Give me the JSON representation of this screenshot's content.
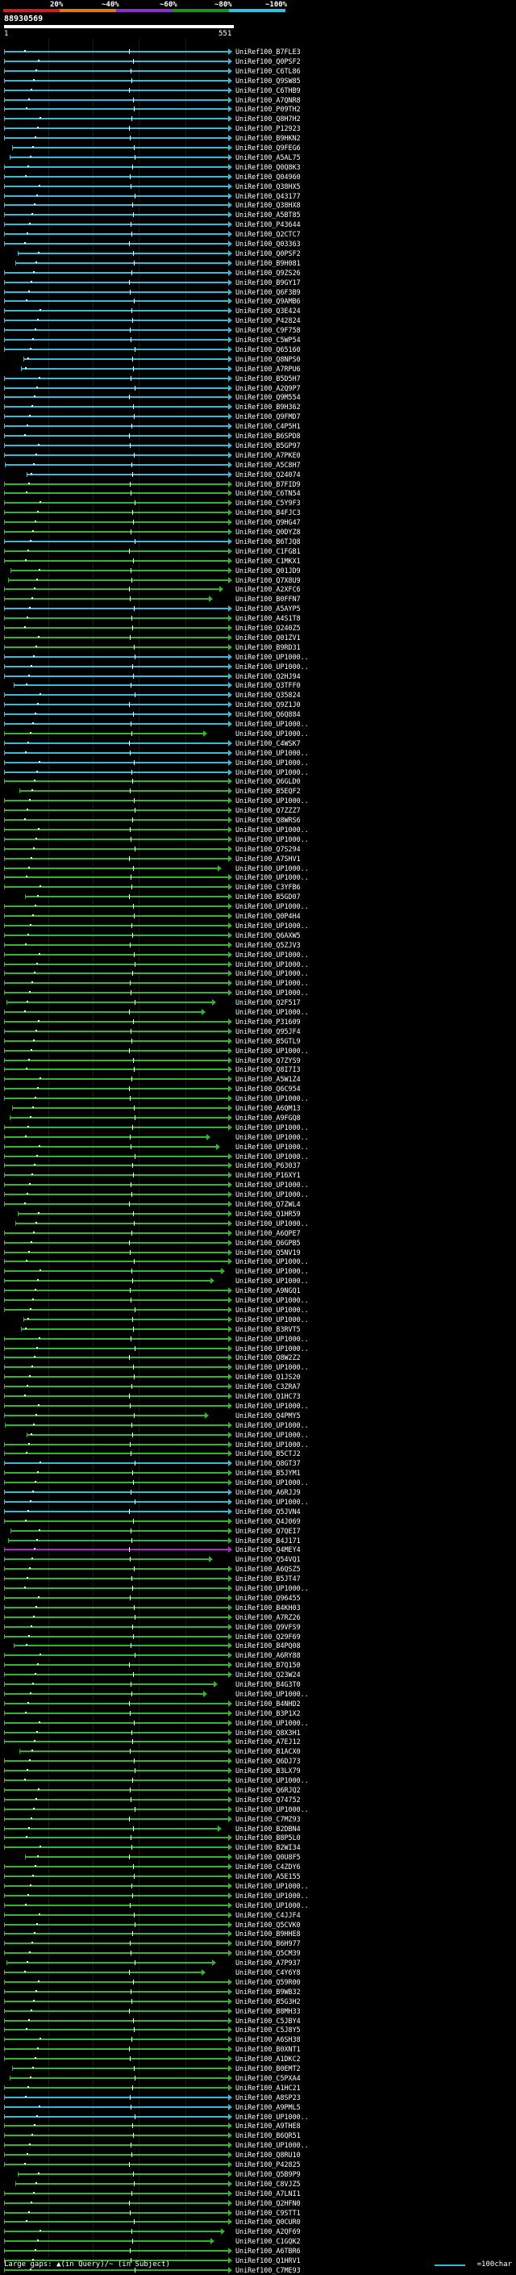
{
  "scale": {
    "ticks": [
      "20%",
      "~40%",
      "~60%",
      "~80%",
      "~100%"
    ],
    "colors": [
      "#cc1f1f",
      "#e07a17",
      "#8b2fc9",
      "#1f8f1f",
      "#33c1e0"
    ]
  },
  "query": {
    "id": "88930569",
    "start": "1",
    "end": "551"
  },
  "colors": {
    "blue": "#39b9d8",
    "green": "#37b42f",
    "magenta": "#b02cc5",
    "white": "#ffffff",
    "background": "#000000"
  },
  "hits": [
    {
      "label": "UniRef100_B7FLE3",
      "color": "blue"
    },
    {
      "label": "UniRef100_Q0PSF2",
      "color": "blue"
    },
    {
      "label": "UniRef100_C6TL86",
      "color": "blue"
    },
    {
      "label": "UniRef100_Q9SW85",
      "color": "blue"
    },
    {
      "label": "UniRef100_C6THB9",
      "color": "blue"
    },
    {
      "label": "UniRef100_A7QNR8",
      "color": "blue"
    },
    {
      "label": "UniRef100_P09TH2",
      "color": "blue"
    },
    {
      "label": "UniRef100_Q8H7H2",
      "color": "blue"
    },
    {
      "label": "UniRef100_P12923",
      "color": "blue"
    },
    {
      "label": "UniRef100_B9HKN2",
      "color": "blue"
    },
    {
      "label": "UniRef100_Q9FEG6",
      "color": "blue"
    },
    {
      "label": "UniRef100_A5AL75",
      "color": "blue"
    },
    {
      "label": "UniRef100_Q0Q8K3",
      "color": "blue"
    },
    {
      "label": "UniRef100_Q04960",
      "color": "blue"
    },
    {
      "label": "UniRef100_Q38HX5",
      "color": "blue"
    },
    {
      "label": "UniRef100_Q43177",
      "color": "blue"
    },
    {
      "label": "UniRef100_Q38HX8",
      "color": "blue"
    },
    {
      "label": "UniRef100_A5BT85",
      "color": "blue"
    },
    {
      "label": "UniRef100_P43644",
      "color": "blue"
    },
    {
      "label": "UniRef100_Q2CTC7",
      "color": "blue"
    },
    {
      "label": "UniRef100_Q03363",
      "color": "blue"
    },
    {
      "label": "UniRef100_Q0PSF2",
      "color": "blue"
    },
    {
      "label": "UniRef100_B9H081",
      "color": "blue"
    },
    {
      "label": "UniRef100_Q9ZS26",
      "color": "blue"
    },
    {
      "label": "UniRef100_B9GY17",
      "color": "blue"
    },
    {
      "label": "UniRef100_Q6F3B9",
      "color": "blue"
    },
    {
      "label": "UniRef100_Q9AMB6",
      "color": "blue"
    },
    {
      "label": "UniRef100_Q3E424",
      "color": "blue"
    },
    {
      "label": "UniRef100_P42824",
      "color": "blue"
    },
    {
      "label": "UniRef100_C9F758",
      "color": "blue"
    },
    {
      "label": "UniRef100_C5WP54",
      "color": "blue"
    },
    {
      "label": "UniRef100_Q65160",
      "color": "blue"
    },
    {
      "label": "UniRef100_Q8NPS0",
      "color": "blue"
    },
    {
      "label": "UniRef100_A7RPU6",
      "color": "blue"
    },
    {
      "label": "UniRef100_B5D5H7",
      "color": "blue"
    },
    {
      "label": "UniRef100_A2Q9P7",
      "color": "blue"
    },
    {
      "label": "UniRef100_Q9M554",
      "color": "blue"
    },
    {
      "label": "UniRef100_B9H362",
      "color": "blue"
    },
    {
      "label": "UniRef100_Q9FMD7",
      "color": "blue"
    },
    {
      "label": "UniRef100_C4P5H1",
      "color": "blue"
    },
    {
      "label": "UniRef100_B6SPD8",
      "color": "blue"
    },
    {
      "label": "UniRef100_B5GP97",
      "color": "blue"
    },
    {
      "label": "UniRef100_A7PKE0",
      "color": "blue"
    },
    {
      "label": "UniRef100_A5C8H7",
      "color": "blue"
    },
    {
      "label": "UniRef100_Q24074",
      "color": "blue"
    },
    {
      "label": "UniRef100_B7FID9",
      "color": "green"
    },
    {
      "label": "UniRef100_C6TN54",
      "color": "green"
    },
    {
      "label": "UniRef100_C5Y9F3",
      "color": "green"
    },
    {
      "label": "UniRef100_B4FJC3",
      "color": "green"
    },
    {
      "label": "UniRef100_Q9HG47",
      "color": "green"
    },
    {
      "label": "UniRef100_Q0DYZ8",
      "color": "green"
    },
    {
      "label": "UniRef100_B6TJQ8",
      "color": "blue"
    },
    {
      "label": "UniRef100_C1FGB1",
      "color": "green"
    },
    {
      "label": "UniRef100_C1MKX1",
      "color": "green"
    },
    {
      "label": "UniRef100_Q01JD9",
      "color": "green"
    },
    {
      "label": "UniRef100_Q7X8U9",
      "color": "green"
    },
    {
      "label": "UniRef100_A2XFC6",
      "color": "green"
    },
    {
      "label": "UniRef100_B0FFN7",
      "color": "green"
    },
    {
      "label": "UniRef100_A5AYP5",
      "color": "blue"
    },
    {
      "label": "UniRef100_A4S1T8",
      "color": "green"
    },
    {
      "label": "UniRef100_Q240Z5",
      "color": "green"
    },
    {
      "label": "UniRef100_Q01ZV1",
      "color": "green"
    },
    {
      "label": "UniRef100_B9RD31",
      "color": "green"
    },
    {
      "label": "UniRef100_UP1000..",
      "color": "blue"
    },
    {
      "label": "UniRef100_UP1000..",
      "color": "blue"
    },
    {
      "label": "UniRef100_Q2HJ94",
      "color": "blue"
    },
    {
      "label": "UniRef100_Q3TFF0",
      "color": "blue"
    },
    {
      "label": "UniRef100_Q35824",
      "color": "blue"
    },
    {
      "label": "UniRef100_Q9Z1J0",
      "color": "blue"
    },
    {
      "label": "UniRef100_Q6Q884",
      "color": "blue"
    },
    {
      "label": "UniRef100_UP1000..",
      "color": "blue"
    },
    {
      "label": "UniRef100_UP1000..",
      "color": "green"
    },
    {
      "label": "UniRef100_C4WSK7",
      "color": "blue"
    },
    {
      "label": "UniRef100_UP1000..",
      "color": "blue"
    },
    {
      "label": "UniRef100_UP1000..",
      "color": "blue"
    },
    {
      "label": "UniRef100_UP1000..",
      "color": "blue"
    },
    {
      "label": "UniRef100_Q6GLD0",
      "color": "green"
    },
    {
      "label": "UniRef100_B5EQF2",
      "color": "green"
    },
    {
      "label": "UniRef100_UP1000..",
      "color": "green"
    },
    {
      "label": "UniRef100_Q7ZZZ7",
      "color": "green"
    },
    {
      "label": "UniRef100_Q8WRS6",
      "color": "green"
    },
    {
      "label": "UniRef100_UP1000..",
      "color": "green"
    },
    {
      "label": "UniRef100_UP1000..",
      "color": "green"
    },
    {
      "label": "UniRef100_Q7S294",
      "color": "green"
    },
    {
      "label": "UniRef100_A7SHV1",
      "color": "green"
    },
    {
      "label": "UniRef100_UP1000..",
      "color": "green"
    },
    {
      "label": "UniRef100_UP1000..",
      "color": "green"
    },
    {
      "label": "UniRef100_C3YFB6",
      "color": "green"
    },
    {
      "label": "UniRef100_B5GD07",
      "color": "green"
    },
    {
      "label": "UniRef100_UP1000..",
      "color": "green"
    },
    {
      "label": "UniRef100_Q0P4H4",
      "color": "green"
    },
    {
      "label": "UniRef100_UP1000..",
      "color": "green"
    },
    {
      "label": "UniRef100_Q6AXW5",
      "color": "green"
    },
    {
      "label": "UniRef100_Q5ZJV3",
      "color": "green"
    },
    {
      "label": "UniRef100_UP1000..",
      "color": "green"
    },
    {
      "label": "UniRef100_UP1000..",
      "color": "green"
    },
    {
      "label": "UniRef100_UP1000..",
      "color": "green"
    },
    {
      "label": "UniRef100_UP1000..",
      "color": "green"
    },
    {
      "label": "UniRef100_UP1000..",
      "color": "green"
    },
    {
      "label": "UniRef100_Q2F517",
      "color": "green"
    },
    {
      "label": "UniRef100_UP1000..",
      "color": "green"
    },
    {
      "label": "UniRef100_P31609",
      "color": "green"
    },
    {
      "label": "UniRef100_Q95JF4",
      "color": "green"
    },
    {
      "label": "UniRef100_B5GTL9",
      "color": "green"
    },
    {
      "label": "UniRef100_UP1000..",
      "color": "green"
    },
    {
      "label": "UniRef100_Q7ZYS9",
      "color": "green"
    },
    {
      "label": "UniRef100_Q8I7I3",
      "color": "green"
    },
    {
      "label": "UniRef100_A5W1Z4",
      "color": "green"
    },
    {
      "label": "UniRef100_Q6C954",
      "color": "green"
    },
    {
      "label": "UniRef100_UP1000..",
      "color": "green"
    },
    {
      "label": "UniRef100_A6QM13",
      "color": "green"
    },
    {
      "label": "UniRef100_A9FGQ8",
      "color": "green"
    },
    {
      "label": "UniRef100_UP1000..",
      "color": "green"
    },
    {
      "label": "UniRef100_UP1000..",
      "color": "green"
    },
    {
      "label": "UniRef100_UP1000..",
      "color": "green"
    },
    {
      "label": "UniRef100_UP1000..",
      "color": "green"
    },
    {
      "label": "UniRef100_P63037",
      "color": "green"
    },
    {
      "label": "UniRef100_P16XY1",
      "color": "green"
    },
    {
      "label": "UniRef100_UP1000..",
      "color": "green"
    },
    {
      "label": "UniRef100_UP1000..",
      "color": "green"
    },
    {
      "label": "UniRef100_Q7ZWL4",
      "color": "green"
    },
    {
      "label": "UniRef100_Q1HR59",
      "color": "green"
    },
    {
      "label": "UniRef100_UP1000..",
      "color": "green"
    },
    {
      "label": "UniRef100_A6QPE7",
      "color": "green"
    },
    {
      "label": "UniRef100_Q6GPB5",
      "color": "green"
    },
    {
      "label": "UniRef100_Q5NV19",
      "color": "green"
    },
    {
      "label": "UniRef100_UP1000..",
      "color": "green"
    },
    {
      "label": "UniRef100_UP1000..",
      "color": "green"
    },
    {
      "label": "UniRef100_UP1000..",
      "color": "green"
    },
    {
      "label": "UniRef100_A9NGQ1",
      "color": "green"
    },
    {
      "label": "UniRef100_UP1000..",
      "color": "green"
    },
    {
      "label": "UniRef100_UP1000..",
      "color": "green"
    },
    {
      "label": "UniRef100_UP1000..",
      "color": "green"
    },
    {
      "label": "UniRef100_B3RVT5",
      "color": "green"
    },
    {
      "label": "UniRef100_UP1000..",
      "color": "green"
    },
    {
      "label": "UniRef100_UP1000..",
      "color": "green"
    },
    {
      "label": "UniRef100_Q8W2Z2",
      "color": "green"
    },
    {
      "label": "UniRef100_UP1000..",
      "color": "green"
    },
    {
      "label": "UniRef100_Q1JS20",
      "color": "green"
    },
    {
      "label": "UniRef100_C3ZRA7",
      "color": "green"
    },
    {
      "label": "UniRef100_Q1HC73",
      "color": "green"
    },
    {
      "label": "UniRef100_UP1000..",
      "color": "green"
    },
    {
      "label": "UniRef100_Q4PMY5",
      "color": "green"
    },
    {
      "label": "UniRef100_UP1000..",
      "color": "green"
    },
    {
      "label": "UniRef100_UP1000..",
      "color": "green"
    },
    {
      "label": "UniRef100_UP1000..",
      "color": "green"
    },
    {
      "label": "UniRef100_B5CTJ2",
      "color": "green"
    },
    {
      "label": "UniRef100_Q8GT37",
      "color": "blue"
    },
    {
      "label": "UniRef100_B5JYM1",
      "color": "green"
    },
    {
      "label": "UniRef100_UP1000..",
      "color": "green"
    },
    {
      "label": "UniRef100_A6RJJ9",
      "color": "blue"
    },
    {
      "label": "UniRef100_UP1000..",
      "color": "blue"
    },
    {
      "label": "UniRef100_Q5JVN4",
      "color": "blue"
    },
    {
      "label": "UniRef100_Q4J069",
      "color": "green"
    },
    {
      "label": "UniRef100_Q7QEI7",
      "color": "green"
    },
    {
      "label": "UniRef100_B4J171",
      "color": "green"
    },
    {
      "label": "UniRef100_Q4MEY4",
      "color": "magenta"
    },
    {
      "label": "UniRef100_Q54VQ1",
      "color": "green"
    },
    {
      "label": "UniRef100_A6QSZ5",
      "color": "green"
    },
    {
      "label": "UniRef100_B5JT47",
      "color": "green"
    },
    {
      "label": "UniRef100_UP1000..",
      "color": "green"
    },
    {
      "label": "UniRef100_Q96455",
      "color": "green"
    },
    {
      "label": "UniRef100_B4KH03",
      "color": "green"
    },
    {
      "label": "UniRef100_A7RZ26",
      "color": "green"
    },
    {
      "label": "UniRef100_Q9VFS9",
      "color": "green"
    },
    {
      "label": "UniRef100_Q29F69",
      "color": "green"
    },
    {
      "label": "UniRef100_B4PQ08",
      "color": "green"
    },
    {
      "label": "UniRef100_A6RY88",
      "color": "green"
    },
    {
      "label": "UniRef100_B7Q150",
      "color": "green"
    },
    {
      "label": "UniRef100_Q23W24",
      "color": "green"
    },
    {
      "label": "UniRef100_B4G3T0",
      "color": "green"
    },
    {
      "label": "UniRef100_UP1000..",
      "color": "green"
    },
    {
      "label": "UniRef100_B4NHD2",
      "color": "green"
    },
    {
      "label": "UniRef100_B3P1X2",
      "color": "green"
    },
    {
      "label": "UniRef100_UP1000..",
      "color": "green"
    },
    {
      "label": "UniRef100_Q8X3H1",
      "color": "green"
    },
    {
      "label": "UniRef100_A7EJ12",
      "color": "green"
    },
    {
      "label": "UniRef100_B1ACX0",
      "color": "green"
    },
    {
      "label": "UniRef100_Q6DJ73",
      "color": "green"
    },
    {
      "label": "UniRef100_B3LX79",
      "color": "green"
    },
    {
      "label": "UniRef100_UP1000..",
      "color": "green"
    },
    {
      "label": "UniRef100_Q6RJQ2",
      "color": "green"
    },
    {
      "label": "UniRef100_Q74752",
      "color": "green"
    },
    {
      "label": "UniRef100_UP1000..",
      "color": "green"
    },
    {
      "label": "UniRef100_C7MZ93",
      "color": "green"
    },
    {
      "label": "UniRef100_B2DBN4",
      "color": "green"
    },
    {
      "label": "UniRef100_B8P5L0",
      "color": "green"
    },
    {
      "label": "UniRef100_B2WI34",
      "color": "green"
    },
    {
      "label": "UniRef100_Q0U8F5",
      "color": "green"
    },
    {
      "label": "UniRef100_C4ZDY6",
      "color": "green"
    },
    {
      "label": "UniRef100_A5E155",
      "color": "green"
    },
    {
      "label": "UniRef100_UP1000..",
      "color": "green"
    },
    {
      "label": "UniRef100_UP1000..",
      "color": "green"
    },
    {
      "label": "UniRef100_UP1000..",
      "color": "green"
    },
    {
      "label": "UniRef100_C4JJF4",
      "color": "green"
    },
    {
      "label": "UniRef100_Q5CVK0",
      "color": "green"
    },
    {
      "label": "UniRef100_B9HHE8",
      "color": "green"
    },
    {
      "label": "UniRef100_B6H977",
      "color": "green"
    },
    {
      "label": "UniRef100_Q5CM39",
      "color": "green"
    },
    {
      "label": "UniRef100_A7P937",
      "color": "green"
    },
    {
      "label": "UniRef100_C4Y6Y8",
      "color": "green"
    },
    {
      "label": "UniRef100_Q59R00",
      "color": "green"
    },
    {
      "label": "UniRef100_B9WB32",
      "color": "green"
    },
    {
      "label": "UniRef100_B5G3H2",
      "color": "green"
    },
    {
      "label": "UniRef100_B8MH33",
      "color": "green"
    },
    {
      "label": "UniRef100_C5JBY4",
      "color": "green"
    },
    {
      "label": "UniRef100_C5J8Y5",
      "color": "green"
    },
    {
      "label": "UniRef100_A6SH38",
      "color": "green"
    },
    {
      "label": "UniRef100_B0XNT1",
      "color": "green"
    },
    {
      "label": "UniRef100_A1DKC2",
      "color": "green"
    },
    {
      "label": "UniRef100_B0EMT2",
      "color": "green"
    },
    {
      "label": "UniRef100_C5PXA4",
      "color": "green"
    },
    {
      "label": "UniRef100_A1HC21",
      "color": "green"
    },
    {
      "label": "UniRef100_A8SP23",
      "color": "blue"
    },
    {
      "label": "UniRef100_A9PML5",
      "color": "blue"
    },
    {
      "label": "UniRef100_UP1000..",
      "color": "blue"
    },
    {
      "label": "UniRef100_A9THE8",
      "color": "green"
    },
    {
      "label": "UniRef100_B6QR51",
      "color": "green"
    },
    {
      "label": "UniRef100_UP1000..",
      "color": "green"
    },
    {
      "label": "UniRef100_Q8RU10",
      "color": "green"
    },
    {
      "label": "UniRef100_P42825",
      "color": "green"
    },
    {
      "label": "UniRef100_Q5B9P9",
      "color": "green"
    },
    {
      "label": "UniRef100_C8VJZ5",
      "color": "green"
    },
    {
      "label": "UniRef100_A7LNI1",
      "color": "green"
    },
    {
      "label": "UniRef100_Q2HFN0",
      "color": "green"
    },
    {
      "label": "UniRef100_C9STT1",
      "color": "green"
    },
    {
      "label": "UniRef100_Q0CUR0",
      "color": "green"
    },
    {
      "label": "UniRef100_A2QF69",
      "color": "green"
    },
    {
      "label": "UniRef100_C1GQK2",
      "color": "green"
    },
    {
      "label": "UniRef100_A6TBR6",
      "color": "green"
    },
    {
      "label": "UniRef100_Q1HRV1",
      "color": "green"
    },
    {
      "label": "UniRef100_C7ME93",
      "color": "green"
    },
    {
      "label": "UniRef100_Q6BRX0",
      "color": "green"
    }
  ],
  "legend": {
    "gaps_text": "Large gaps: ▲(in Query)/~ (in Subject)",
    "scale_text": "=100char"
  }
}
